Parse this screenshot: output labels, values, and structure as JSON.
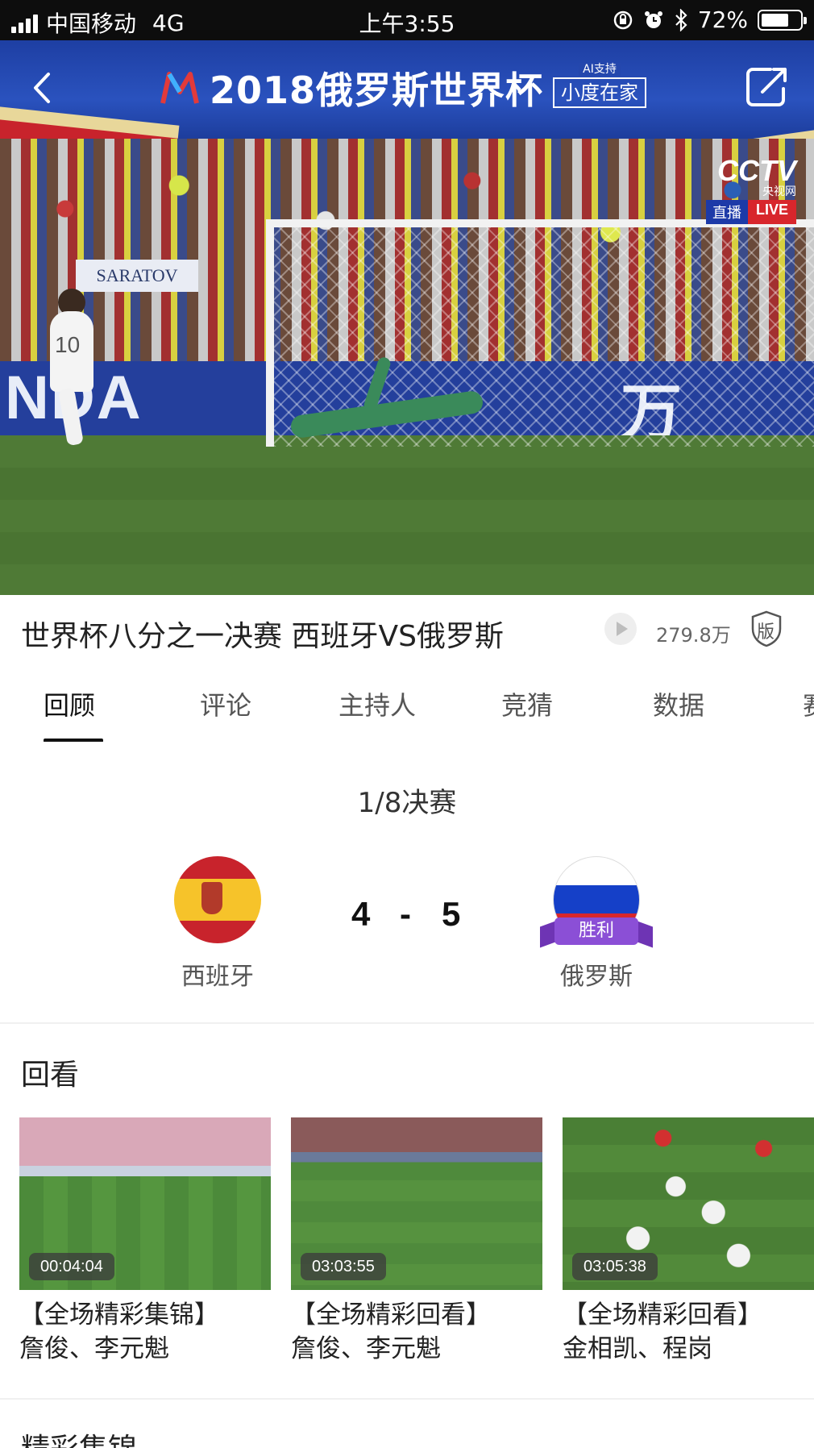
{
  "status_bar": {
    "carrier": "中国移动",
    "network": "4G",
    "time": "上午3:55",
    "battery": "72%",
    "battery_level": 0.72,
    "icons": [
      "lock-rotation-icon",
      "alarm-icon",
      "bluetooth-icon"
    ]
  },
  "header": {
    "title": "2018俄罗斯世界杯",
    "ai_badge_top": "AI支持",
    "ai_badge_label": "小度在家",
    "back_icon": "back-chevron-icon",
    "share_icon": "share-icon",
    "colors": {
      "background": "#2447ad",
      "accent_red": "#c8232c",
      "accent_gold": "#e8d79a"
    }
  },
  "video": {
    "banner_text": "SARATOV",
    "adboard_left": "NDA",
    "adboard_right": "万",
    "player_number": "10",
    "broadcaster": "CCTV",
    "broadcaster_sub": "央视网",
    "live_cn": "直播",
    "live_en": "LIVE"
  },
  "title_row": {
    "title": "世界杯八分之一决赛 西班牙VS俄罗斯",
    "views": "279.8万",
    "copyright_badge": "版"
  },
  "tabs": [
    {
      "label": "回顾",
      "active": true
    },
    {
      "label": "评论",
      "active": false
    },
    {
      "label": "主持人",
      "active": false
    },
    {
      "label": "竞猜",
      "active": false
    },
    {
      "label": "数据",
      "active": false
    },
    {
      "label": "赛",
      "active": false
    }
  ],
  "match": {
    "round": "1/8决赛",
    "home": {
      "name": "西班牙",
      "score": "4"
    },
    "separator": "-",
    "away": {
      "name": "俄罗斯",
      "score": "5",
      "badge": "胜利"
    },
    "colors": {
      "win_badge": "#8b4fd6"
    }
  },
  "replay": {
    "section_title": "回看",
    "items": [
      {
        "duration": "00:04:04",
        "title_line1": "【全场精彩集锦】",
        "title_line2": "詹俊、李元魁"
      },
      {
        "duration": "03:03:55",
        "title_line1": "【全场精彩回看】",
        "title_line2": "詹俊、李元魁"
      },
      {
        "duration": "03:05:38",
        "title_line1": "【全场精彩回看】",
        "title_line2": "金相凯、程岗"
      }
    ]
  },
  "highlights": {
    "section_title": "精彩集锦"
  }
}
